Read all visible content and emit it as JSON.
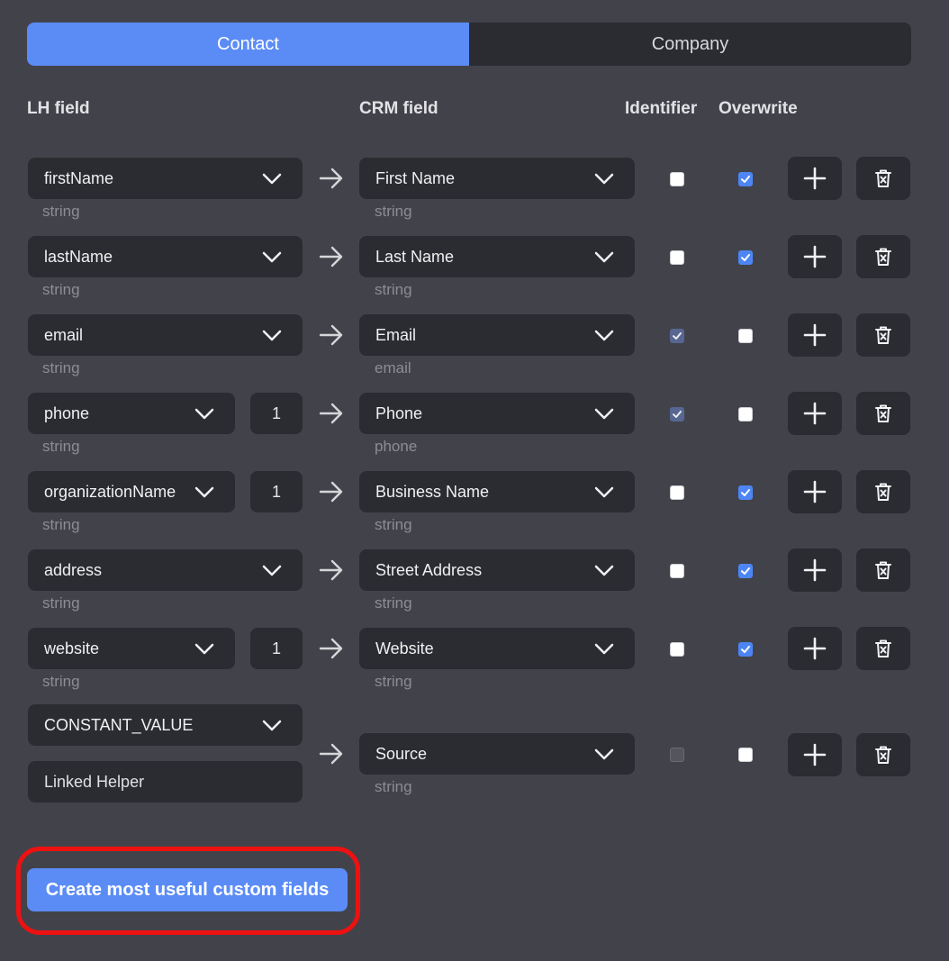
{
  "tabs": {
    "contact": "Contact",
    "company": "Company",
    "active": "contact"
  },
  "headers": {
    "lh_field": "LH field",
    "crm_field": "CRM field",
    "identifier": "Identifier",
    "overwrite": "Overwrite"
  },
  "rows": [
    {
      "lh": "firstName",
      "lh_type": "string",
      "index": null,
      "crm": "First Name",
      "crm_type": "string",
      "identifier": "unchecked",
      "overwrite": "checked"
    },
    {
      "lh": "lastName",
      "lh_type": "string",
      "index": null,
      "crm": "Last Name",
      "crm_type": "string",
      "identifier": "unchecked",
      "overwrite": "checked"
    },
    {
      "lh": "email",
      "lh_type": "string",
      "index": null,
      "crm": "Email",
      "crm_type": "email",
      "identifier": "checked-dim",
      "overwrite": "unchecked"
    },
    {
      "lh": "phone",
      "lh_type": "string",
      "index": "1",
      "crm": "Phone",
      "crm_type": "phone",
      "identifier": "checked-dim",
      "overwrite": "unchecked"
    },
    {
      "lh": "organizationName",
      "lh_type": "string",
      "index": "1",
      "crm": "Business Name",
      "crm_type": "string",
      "identifier": "unchecked",
      "overwrite": "checked"
    },
    {
      "lh": "address",
      "lh_type": "string",
      "index": null,
      "crm": "Street Address",
      "crm_type": "string",
      "identifier": "unchecked",
      "overwrite": "checked"
    },
    {
      "lh": "website",
      "lh_type": "string",
      "index": "1",
      "crm": "Website",
      "crm_type": "string",
      "identifier": "unchecked",
      "overwrite": "checked"
    }
  ],
  "constant_row": {
    "lh": "CONSTANT_VALUE",
    "value": "Linked Helper",
    "crm": "Source",
    "crm_type": "string",
    "identifier": "disabled",
    "overwrite": "unchecked"
  },
  "icons": {
    "add": "plus-icon",
    "delete": "trash-icon",
    "arrow": "arrow-right-icon",
    "dropdown": "chevron-down-icon"
  },
  "cta": {
    "label": "Create most useful custom fields"
  },
  "colors": {
    "accent": "#5b8cf6",
    "background": "#42434a",
    "control": "#2b2c31",
    "highlight": "#ee1111"
  }
}
